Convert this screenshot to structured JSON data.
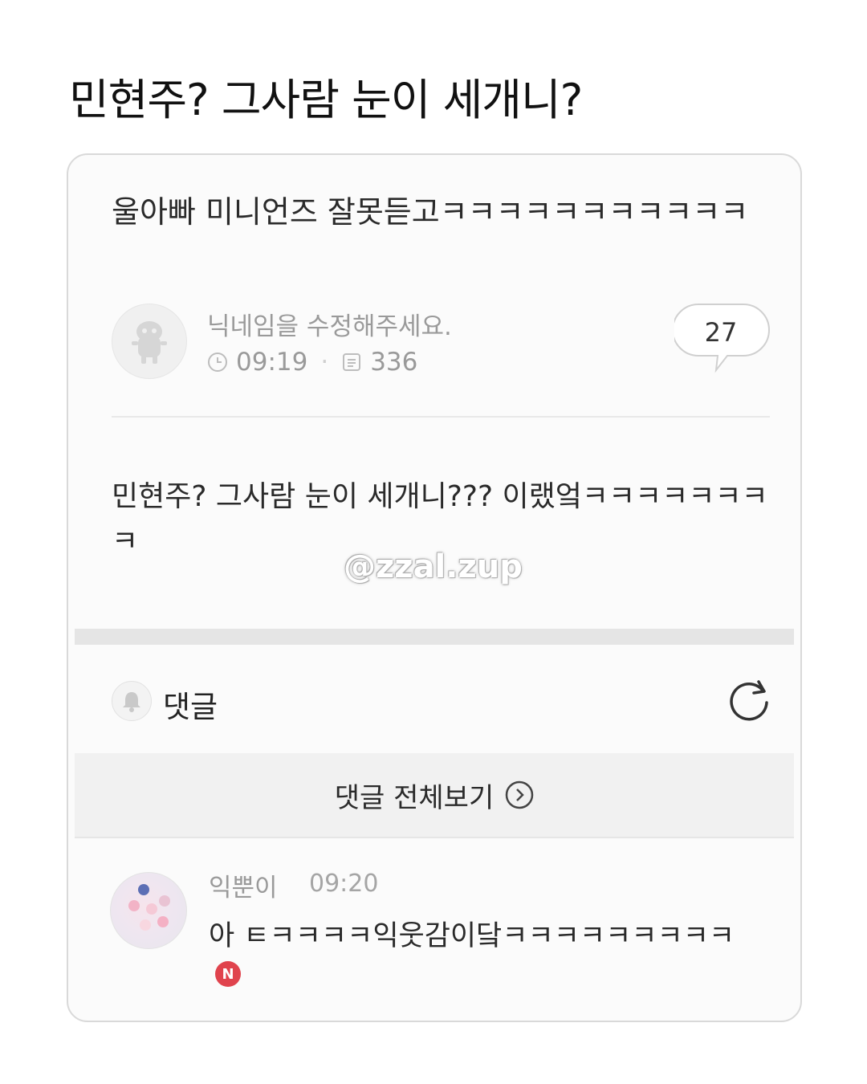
{
  "headline": "민현주? 그사람 눈이 세개니?",
  "post": {
    "title": "울아빠 미니언즈 잘못듣고ㅋㅋㅋㅋㅋㅋㅋㅋㅋㅋㅋ",
    "author": "닉네임을 수정해주세요.",
    "time": "09:19",
    "views": "336",
    "comment_count": "27",
    "body": "민현주? 그사람 눈이 세개니??? 이랬엌ㅋㅋㅋㅋㅋㅋㅋㅋ"
  },
  "watermark": "@zzal.zup",
  "comments_section": {
    "label": "댓글",
    "view_all": "댓글 전체보기"
  },
  "comment": {
    "name": "익뿐이",
    "time": "09:20",
    "text": "아 ㅌㅋㅋㅋㅋ익웃감이닼ㅋㅋㅋㅋㅋㅋㅋㅋㅋ",
    "badge": "N"
  },
  "colors": {
    "badge_red": "#e0434d",
    "meta_gray": "#9a9a9a",
    "band_gray": "#e5e5e5"
  }
}
